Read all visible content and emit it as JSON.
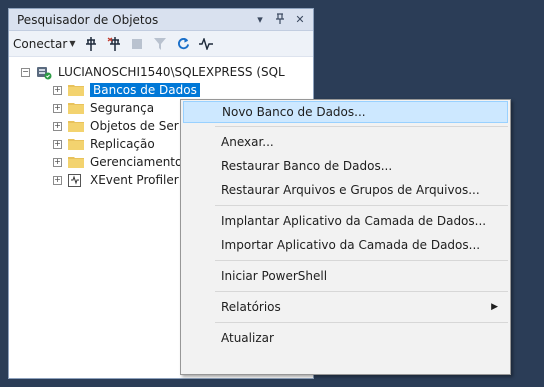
{
  "panel": {
    "title": "Pesquisador de Objetos",
    "controls": {
      "dropdown": "▼",
      "pin": "ᵖ",
      "close": "×"
    }
  },
  "toolbar": {
    "connect_label": "Conectar"
  },
  "tree": {
    "server_label": "LUCIANOSCHI1540\\SQLEXPRESS (SQL",
    "items": [
      {
        "label": "Bancos de Dados",
        "selected": true
      },
      {
        "label": "Segurança"
      },
      {
        "label": "Objetos de Ser"
      },
      {
        "label": "Replicação"
      },
      {
        "label": "Gerenciamento"
      },
      {
        "label": "XEvent Profiler"
      }
    ]
  },
  "context_menu": {
    "new_db": "Novo Banco de Dados...",
    "attach": "Anexar...",
    "restore_db": "Restaurar Banco de Dados...",
    "restore_files": "Restaurar Arquivos e Grupos de Arquivos...",
    "deploy_dac": "Implantar Aplicativo da Camada de Dados...",
    "import_dac": "Importar Aplicativo da Camada de Dados...",
    "powershell": "Iniciar PowerShell",
    "reports": "Relatórios",
    "refresh": "Atualizar"
  },
  "colors": {
    "background": "#2b3d57",
    "selection": "#0078d7",
    "menu_highlight": "#cde8ff"
  }
}
